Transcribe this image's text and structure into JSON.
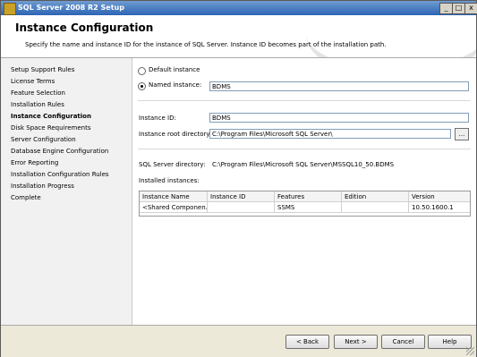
{
  "window": {
    "title": "SQL Server 2008 R2 Setup",
    "minimize": "_",
    "maximize": "□",
    "close": "x"
  },
  "header": {
    "title": "Instance Configuration",
    "description": "Specify the name and instance ID for the instance of SQL Server. Instance ID becomes part of the installation path."
  },
  "sidebar": {
    "items": [
      {
        "label": "Setup Support Rules"
      },
      {
        "label": "License Terms"
      },
      {
        "label": "Feature Selection"
      },
      {
        "label": "Installation Rules"
      },
      {
        "label": "Instance Configuration"
      },
      {
        "label": "Disk Space Requirements"
      },
      {
        "label": "Server Configuration"
      },
      {
        "label": "Database Engine Configuration"
      },
      {
        "label": "Error Reporting"
      },
      {
        "label": "Installation Configuration Rules"
      },
      {
        "label": "Installation Progress"
      },
      {
        "label": "Complete"
      }
    ],
    "active_index": 4
  },
  "form": {
    "default_instance_label": "Default instance",
    "named_instance_label": "Named instance:",
    "named_instance_value": "BDMS",
    "instance_id_label": "Instance ID:",
    "instance_id_value": "BDMS",
    "root_dir_label": "Instance root directory:",
    "root_dir_value": "C:\\Program Files\\Microsoft SQL Server\\",
    "browse_label": "...",
    "sql_dir_label": "SQL Server directory:",
    "sql_dir_value": "C:\\Program Files\\Microsoft SQL Server\\MSSQL10_50.BDMS",
    "installed_label": "Installed instances:"
  },
  "table": {
    "headers": [
      "Instance Name",
      "Instance ID",
      "Features",
      "Edition",
      "Version"
    ],
    "rows": [
      [
        "<Shared Componen...",
        "",
        "SSMS",
        "",
        "10.50.1600.1"
      ]
    ]
  },
  "footer": {
    "back": "< Back",
    "next": "Next >",
    "cancel": "Cancel",
    "help": "Help"
  }
}
